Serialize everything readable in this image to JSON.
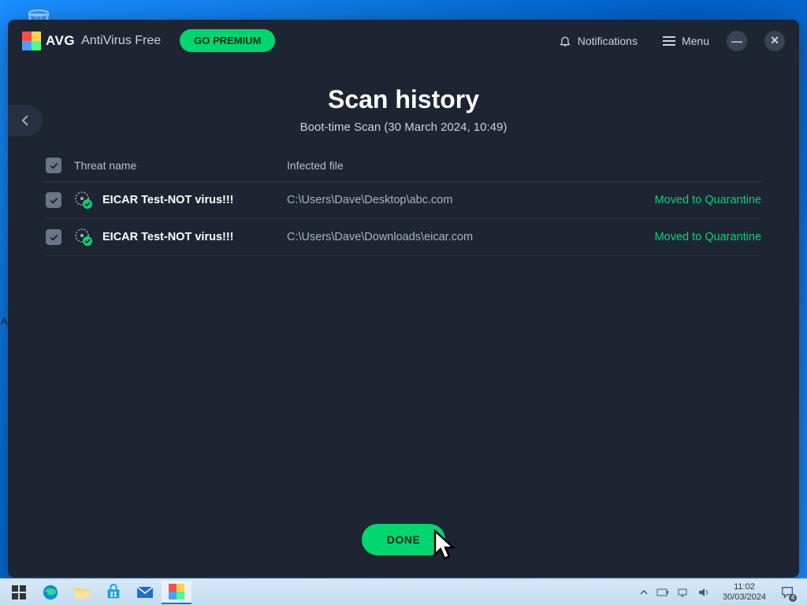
{
  "titlebar": {
    "brand": "AVG",
    "product": "AntiVirus Free",
    "premium_label": "GO PREMIUM",
    "notifications_label": "Notifications",
    "menu_label": "Menu"
  },
  "page": {
    "title": "Scan history",
    "subtitle": "Boot-time Scan (30 March 2024, 10:49)"
  },
  "table": {
    "header_name": "Threat name",
    "header_file": "Infected file",
    "rows": [
      {
        "name": "EICAR Test-NOT virus!!!",
        "file": "C:\\Users\\Dave\\Desktop\\abc.com",
        "status": "Moved to Quarantine"
      },
      {
        "name": "EICAR Test-NOT virus!!!",
        "file": "C:\\Users\\Dave\\Downloads\\eicar.com",
        "status": "Moved to Quarantine"
      }
    ]
  },
  "actions": {
    "done_label": "DONE"
  },
  "taskbar": {
    "time": "11:02",
    "date": "30/03/2024",
    "badge": "4"
  }
}
